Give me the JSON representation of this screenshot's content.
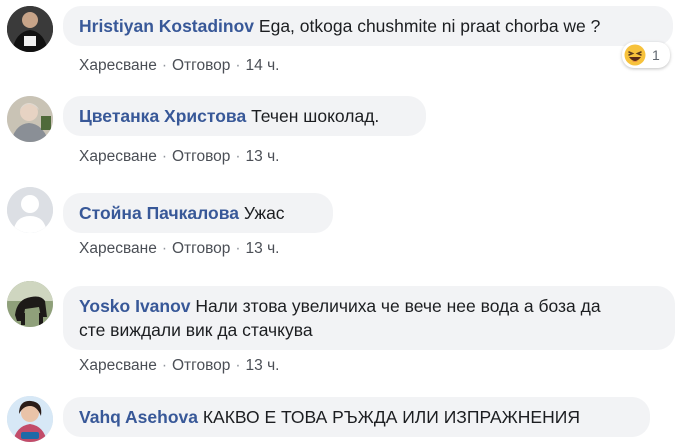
{
  "comments": [
    {
      "author": "Hristiyan Kostadinov",
      "text": "Ega, otkoga chushmite ni praat chorba we ?",
      "like": "Харесване",
      "reply": "Отговор",
      "time": "14 ч.",
      "reaction": {
        "icon": "laughing-emoji-icon",
        "count": "1"
      }
    },
    {
      "author": "Цветанка Христова",
      "text": "Течен шоколад.",
      "like": "Харесване",
      "reply": "Отговор",
      "time": "13 ч."
    },
    {
      "author": "Стойна Пачкалова",
      "text": "Ужас",
      "like": "Харесване",
      "reply": "Отговор",
      "time": "13 ч."
    },
    {
      "author": "Yosko Ivanov",
      "text_line1": "Нали зтова увеличиха че вече нее вода а боза да",
      "text_line2": "сте виждали вик да стачкува",
      "like": "Харесване",
      "reply": "Отговор",
      "time": "13 ч."
    },
    {
      "author": "Vahq Asehova",
      "text": "КАКВО Е ТОВА РЪЖДА ИЛИ ИЗПРАЖНЕНИЯ"
    }
  ],
  "colors": {
    "author_link": "#385898",
    "bubble_bg": "#f2f3f5",
    "meta_text": "#4b4f56"
  }
}
